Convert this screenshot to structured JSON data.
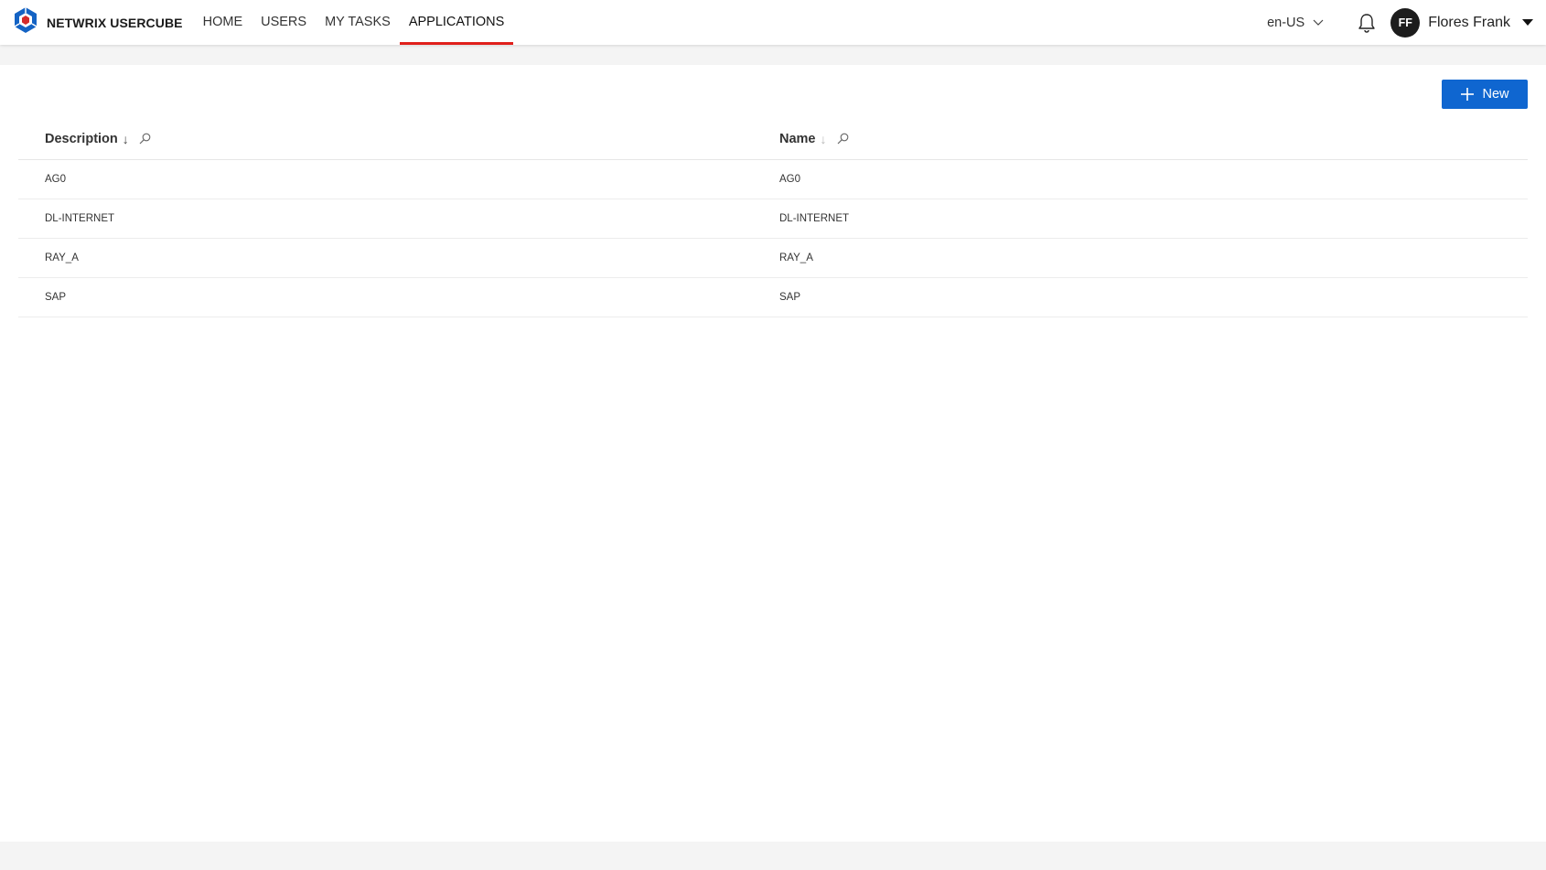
{
  "header": {
    "brand": "NETWRIX USERCUBE",
    "nav": [
      {
        "label": "HOME"
      },
      {
        "label": "USERS"
      },
      {
        "label": "MY TASKS"
      },
      {
        "label": "APPLICATIONS",
        "active": true
      }
    ],
    "language": "en-US",
    "user": {
      "initials": "FF",
      "name": "Flores Frank"
    }
  },
  "toolbar": {
    "new_label": "New"
  },
  "table": {
    "columns": [
      {
        "label": "Description",
        "sort": "descending-active"
      },
      {
        "label": "Name",
        "sort": "descending-inactive"
      }
    ],
    "rows": [
      {
        "description": "AG0",
        "name": "AG0"
      },
      {
        "description": "DL-INTERNET",
        "name": "DL-INTERNET"
      },
      {
        "description": "RAY_A",
        "name": "RAY_A"
      },
      {
        "description": "SAP",
        "name": "SAP"
      }
    ]
  },
  "colors": {
    "accent": "#0f66d0",
    "active_tab_underline": "#e0201b",
    "avatar_bg": "#1c1c1c",
    "logo_blue": "#1463c4",
    "logo_red": "#d42a2a"
  },
  "icons": [
    "usercube-logo",
    "chevron-down-icon",
    "bell-icon",
    "caret-down-icon",
    "plus-icon",
    "search-icon",
    "arrow-down-icon"
  ]
}
